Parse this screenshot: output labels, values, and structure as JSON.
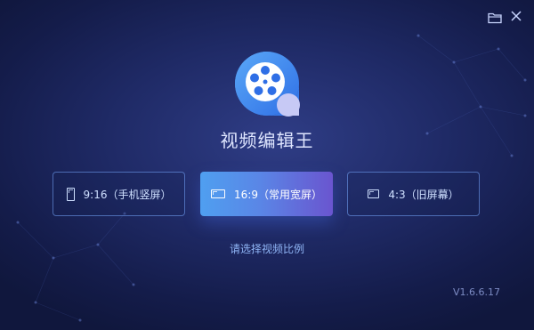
{
  "app": {
    "title": "视频编辑王",
    "version": "V1.6.6.17",
    "hint": "请选择视频比例"
  },
  "toolbar": {
    "folder_icon": "folder-icon",
    "close_icon": "close-icon"
  },
  "ratios": [
    {
      "label": "9:16（手机竖屏）",
      "icon": "portrait-screen-icon",
      "selected": false
    },
    {
      "label": "16:9（常用宽屏）",
      "icon": "widescreen-icon",
      "selected": true
    },
    {
      "label": "4:3（旧屏幕）",
      "icon": "standard-screen-icon",
      "selected": false
    }
  ],
  "colors": {
    "accent_start": "#4f9ff0",
    "accent_end": "#6a55cf",
    "logo_blue": "#3d8bf0"
  }
}
